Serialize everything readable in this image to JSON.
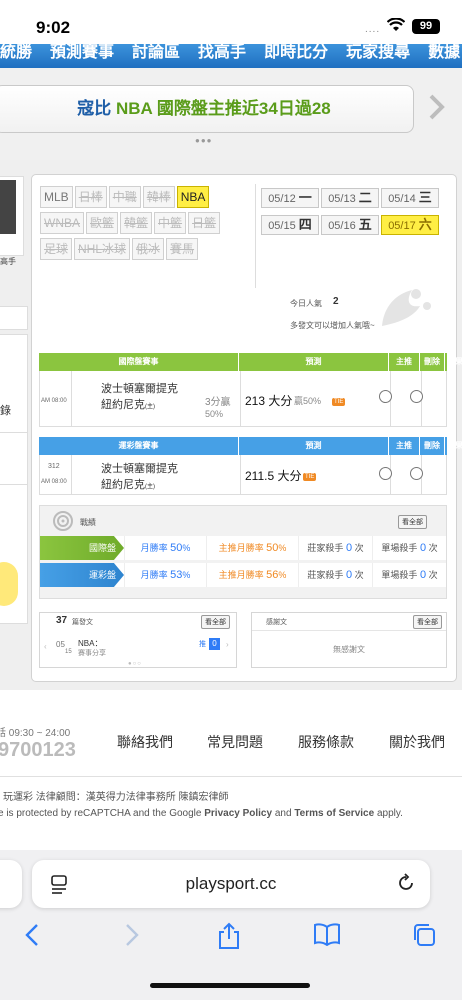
{
  "status_bar": {
    "time": "9:02",
    "signal": "....",
    "battery": "99"
  },
  "nav": {
    "items": [
      "統勝",
      "預測賽事",
      "討論區",
      "找高手",
      "即時比分",
      "玩家搜尋",
      "數據"
    ]
  },
  "promo": {
    "brand": "寇比",
    "text": "NBA 國際盤主推近34日過28",
    "dots": "●●●"
  },
  "left_partial": {
    "caption": "高手",
    "text": "錄"
  },
  "leagues": [
    {
      "label": "MLB",
      "state": "plain"
    },
    {
      "label": "日棒",
      "state": "disabled"
    },
    {
      "label": "中職",
      "state": "disabled"
    },
    {
      "label": "韓棒",
      "state": "disabled"
    },
    {
      "label": "NBA",
      "state": "active"
    },
    {
      "label": "WNBA",
      "state": "disabled"
    },
    {
      "label": "歐籃",
      "state": "disabled"
    },
    {
      "label": "韓籃",
      "state": "disabled"
    },
    {
      "label": "中籃",
      "state": "disabled"
    },
    {
      "label": "日籃",
      "state": "disabled"
    },
    {
      "label": "足球",
      "state": "disabled"
    },
    {
      "label": "NHL冰球",
      "state": "disabled"
    },
    {
      "label": "俄冰",
      "state": "disabled"
    },
    {
      "label": "賽馬",
      "state": "disabled"
    }
  ],
  "dates": [
    {
      "date": "05/12",
      "day": "一",
      "active": false
    },
    {
      "date": "05/13",
      "day": "二",
      "active": false
    },
    {
      "date": "05/14",
      "day": "三",
      "active": false
    },
    {
      "date": "05/15",
      "day": "四",
      "active": false
    },
    {
      "date": "05/16",
      "day": "五",
      "active": false
    },
    {
      "date": "05/17",
      "day": "六",
      "active": true
    }
  ],
  "popularity": {
    "label": "今日人氣",
    "value": "2",
    "tip": "多發文可以增加人氣哦~"
  },
  "intl_table": {
    "headers": {
      "event": "國際盤賽事",
      "pred": "預測",
      "main": "主推",
      "del": "刪除",
      "result": "結果"
    },
    "row": {
      "num": "",
      "time": "AM 08:00",
      "team1": "波士頓塞爾提克",
      "team2": "紐約尼克",
      "team2_suffix": "(主)",
      "spread": "3分贏",
      "spread_pct": "50%",
      "pick": "213 大分",
      "win_rate": "贏50%",
      "badge": "TIE"
    }
  },
  "lottery_table": {
    "headers": {
      "event": "運彩盤賽事",
      "pred": "預測",
      "main": "主推",
      "del": "刪除",
      "result": "結果"
    },
    "row": {
      "num": "312",
      "time": "AM 08:00",
      "team1": "波士頓塞爾提克",
      "team2": "紐約尼克",
      "team2_suffix": "(主)",
      "pick": "211.5 大分",
      "badge": "TIE"
    }
  },
  "record": {
    "title": "戰績",
    "view_all": "看全部",
    "rows": [
      {
        "label": "國際盤",
        "month_label": "月勝率",
        "month_val": "50",
        "main_label": "主推月勝率",
        "main_val": "50",
        "banker_label": "莊家殺手",
        "banker_val": "0",
        "single_label": "單場殺手",
        "single_val": "0",
        "unit": "次",
        "pct": "%"
      },
      {
        "label": "運彩盤",
        "month_label": "月勝率",
        "month_val": "53",
        "main_label": "主推月勝率",
        "main_val": "56",
        "banker_label": "莊家殺手",
        "banker_val": "0",
        "single_label": "單場殺手",
        "single_val": "0",
        "unit": "次",
        "pct": "%"
      }
    ],
    "colors": {
      "intl": "#8bc53f",
      "lottery": "#46a0e6",
      "highlight": "#f08a24"
    }
  },
  "posts": {
    "count": "37",
    "label": "篇發文",
    "view_all": "看全部",
    "item_month": "05",
    "item_day": "15",
    "item_title": "NBA：",
    "item_sub": "賽事分享",
    "item_tag": "推",
    "item_tag_count": "0"
  },
  "thanks": {
    "label": "感謝文",
    "view_all": "看全部",
    "empty": "無感謝文"
  },
  "footer": {
    "hours": "話 09:30 ~ 24:00",
    "phone": "9700123",
    "links": [
      "聯絡我們",
      "常見問題",
      "服務條款",
      "關於我們"
    ],
    "legal": "玩運彩 法律顧問：漢英得力法律事務所 陳鎮宏律師",
    "recaptcha_pre": "e is protected by reCAPTCHA and the Google",
    "privacy": "Privacy Policy",
    "and": "and",
    "terms": "Terms of Service",
    "apply": "apply."
  },
  "browser": {
    "url": "playsport.cc"
  }
}
